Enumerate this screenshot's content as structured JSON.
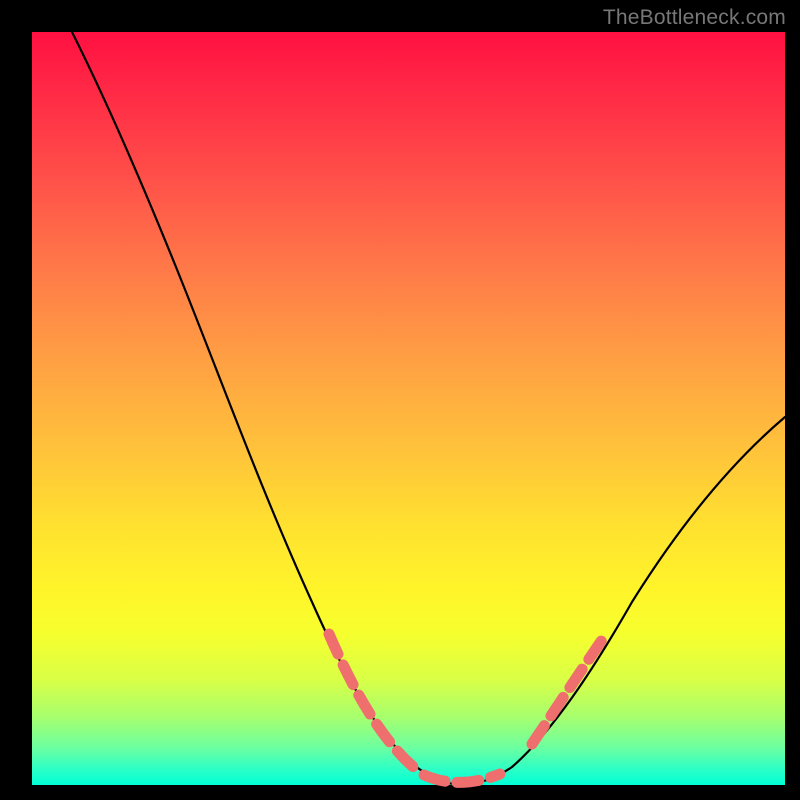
{
  "watermark": "TheBottleneck.com",
  "colors": {
    "background": "#000000",
    "curve": "#000000",
    "highlight": "#ef6e6e",
    "watermark_text": "#777777"
  },
  "chart_data": {
    "type": "line",
    "title": "",
    "xlabel": "",
    "ylabel": "",
    "xlim": [
      0,
      1
    ],
    "ylim": [
      0,
      1
    ],
    "annotations": [
      "TheBottleneck.com"
    ],
    "series": [
      {
        "name": "bottleneck-curve",
        "x": [
          0.05,
          0.1,
          0.15,
          0.2,
          0.25,
          0.3,
          0.35,
          0.4,
          0.45,
          0.5,
          0.55,
          0.6,
          0.65,
          0.7,
          0.75,
          0.8,
          0.85,
          0.9,
          0.95,
          1.0
        ],
        "values": [
          1.0,
          0.92,
          0.82,
          0.7,
          0.58,
          0.46,
          0.35,
          0.24,
          0.14,
          0.06,
          0.01,
          0.0,
          0.01,
          0.05,
          0.11,
          0.18,
          0.26,
          0.34,
          0.42,
          0.49
        ]
      },
      {
        "name": "highlight-range",
        "x": [
          0.4,
          0.7
        ],
        "values": [
          0.24,
          0.05
        ]
      }
    ]
  }
}
